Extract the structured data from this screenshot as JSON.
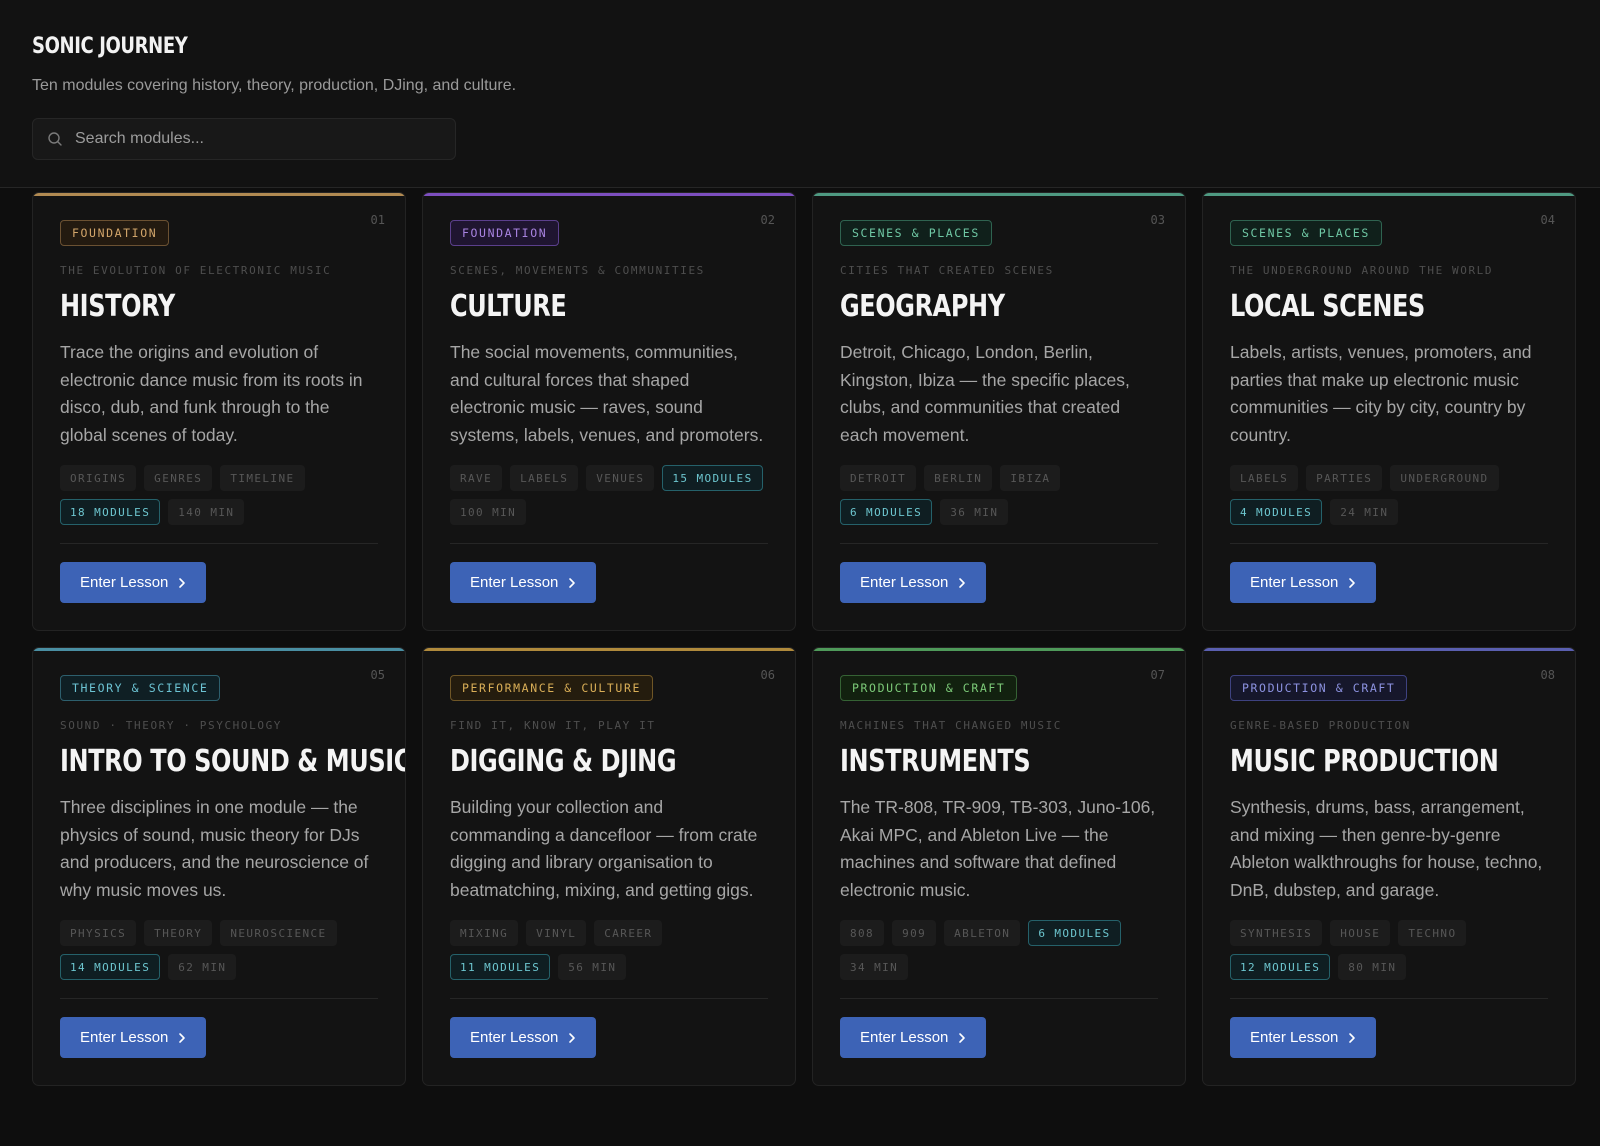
{
  "header": {
    "brand": "SONIC JOURNEY",
    "subtitle": "Ten modules covering history, theory, production, DJing, and culture.",
    "search_placeholder": "Search modules..."
  },
  "button_label": "Enter Lesson",
  "cards": [
    {
      "number": "01",
      "category": "FOUNDATION",
      "kicker": "THE EVOLUTION OF ELECTRONIC MUSIC",
      "title": "HISTORY",
      "description": "Trace the origins and evolution of electronic dance music from its roots in disco, dub, and funk through to the global scenes of today.",
      "tags": [
        "ORIGINS",
        "GENRES",
        "TIMELINE"
      ],
      "modules": "18 MODULES",
      "duration": "140 MIN",
      "accent": "#b18a52"
    },
    {
      "number": "02",
      "category": "FOUNDATION",
      "kicker": "SCENES, MOVEMENTS & COMMUNITIES",
      "title": "CULTURE",
      "description": "The social movements, communities, and cultural forces that shaped electronic music — raves, sound systems, labels, venues, and promoters.",
      "tags": [
        "RAVE",
        "LABELS",
        "VENUES"
      ],
      "modules": "15 MODULES",
      "duration": "100 MIN",
      "accent": "#7d4fbf"
    },
    {
      "number": "03",
      "category": "SCENES & PLACES",
      "kicker": "CITIES THAT CREATED SCENES",
      "title": "GEOGRAPHY",
      "description": "Detroit, Chicago, London, Berlin, Kingston, Ibiza — the specific places, clubs, and communities that created each movement.",
      "tags": [
        "DETROIT",
        "BERLIN",
        "IBIZA"
      ],
      "modules": "6 MODULES",
      "duration": "36 MIN",
      "accent": "#4f9a82"
    },
    {
      "number": "04",
      "category": "SCENES & PLACES",
      "kicker": "THE UNDERGROUND AROUND THE WORLD",
      "title": "LOCAL SCENES",
      "description": "Labels, artists, venues, promoters, and parties that make up electronic music communities — city by city, country by country.",
      "tags": [
        "LABELS",
        "PARTIES",
        "UNDERGROUND"
      ],
      "modules": "4 MODULES",
      "duration": "24 MIN",
      "accent": "#4f9a82"
    },
    {
      "number": "05",
      "category": "THEORY & SCIENCE",
      "kicker": "SOUND · THEORY · PSYCHOLOGY",
      "title": "INTRO TO SOUND & MUSIC",
      "description": "Three disciplines in one module — the physics of sound, music theory for DJs and producers, and the neuroscience of why music moves us.",
      "tags": [
        "PHYSICS",
        "THEORY",
        "NEUROSCIENCE"
      ],
      "modules": "14 MODULES",
      "duration": "62 MIN",
      "accent": "#4a8fa3"
    },
    {
      "number": "06",
      "category": "PERFORMANCE & CULTURE",
      "kicker": "FIND IT, KNOW IT, PLAY IT",
      "title": "DIGGING & DJING",
      "description": "Building your collection and commanding a dancefloor — from crate digging and library organisation to beatmatching, mixing, and getting gigs.",
      "tags": [
        "MIXING",
        "VINYL",
        "CAREER"
      ],
      "modules": "11 MODULES",
      "duration": "56 MIN",
      "accent": "#b08a3c"
    },
    {
      "number": "07",
      "category": "PRODUCTION & CRAFT",
      "kicker": "MACHINES THAT CHANGED MUSIC",
      "title": "INSTRUMENTS",
      "description": "The TR-808, TR-909, TB-303, Juno-106, Akai MPC, and Ableton Live — the machines and software that defined electronic music.",
      "tags": [
        "808",
        "909",
        "ABLETON"
      ],
      "modules": "6 MODULES",
      "duration": "34 MIN",
      "accent": "#4f9a5a"
    },
    {
      "number": "08",
      "category": "PRODUCTION & CRAFT",
      "kicker": "GENRE-BASED PRODUCTION",
      "title": "MUSIC PRODUCTION",
      "description": "Synthesis, drums, bass, arrangement, and mixing — then genre-by-genre Ableton walkthroughs for house, techno, DnB, dubstep, and garage.",
      "tags": [
        "SYNTHESIS",
        "HOUSE",
        "TECHNO"
      ],
      "modules": "12 MODULES",
      "duration": "80 MIN",
      "accent": "#5a5fb0"
    }
  ],
  "badge_styles": {
    "FOUNDATION_1": {
      "bg": "#231a10",
      "border": "#6b5132",
      "color": "#d2a56a"
    },
    "FOUNDATION_2": {
      "bg": "#1f1530",
      "border": "#5b3f8c",
      "color": "#a883e0"
    },
    "SCENES_3": {
      "bg": "#10201b",
      "border": "#2f6350",
      "color": "#6fc7a4"
    },
    "SCENES_4": {
      "bg": "#10201b",
      "border": "#2f6350",
      "color": "#6fc7a4"
    },
    "THEORY_5": {
      "bg": "#0f1f24",
      "border": "#2d5f6d",
      "color": "#6cc3d3"
    },
    "PERF_6": {
      "bg": "#241c0e",
      "border": "#6f5626",
      "color": "#d9ae57"
    },
    "PROD_7": {
      "bg": "#12210f",
      "border": "#356234",
      "color": "#7cca78"
    },
    "PROD_8": {
      "bg": "#16172b",
      "border": "#3e4280",
      "color": "#8c92e0"
    }
  }
}
